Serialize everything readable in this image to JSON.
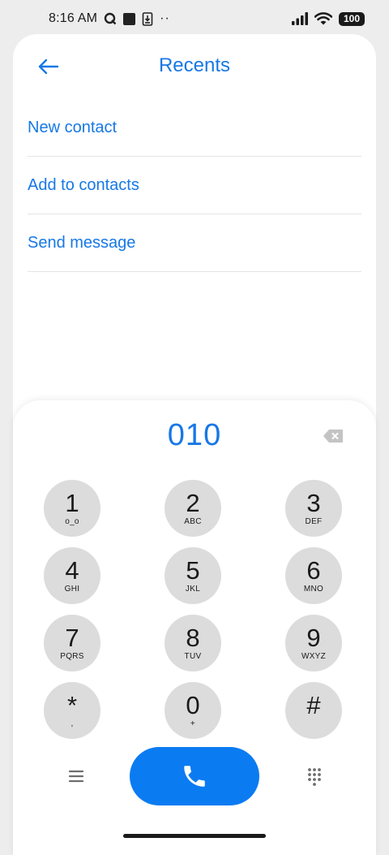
{
  "status_bar": {
    "time": "8:16 AM",
    "battery": "100",
    "icons": [
      "q-app-icon",
      "square-icon",
      "sim-download-icon",
      "more-dots-icon",
      "signal-icon",
      "wifi-icon",
      "battery-icon"
    ],
    "dots": "··"
  },
  "header": {
    "title": "Recents",
    "back_icon": "arrow-left-icon"
  },
  "menu": {
    "items": [
      {
        "label": "New contact"
      },
      {
        "label": "Add to contacts"
      },
      {
        "label": "Send message"
      }
    ]
  },
  "dialer": {
    "number": "010",
    "backspace_icon": "backspace-icon",
    "keys": [
      {
        "digit": "1",
        "letters": "o_o"
      },
      {
        "digit": "2",
        "letters": "ABC"
      },
      {
        "digit": "3",
        "letters": "DEF"
      },
      {
        "digit": "4",
        "letters": "GHI"
      },
      {
        "digit": "5",
        "letters": "JKL"
      },
      {
        "digit": "6",
        "letters": "MNO"
      },
      {
        "digit": "7",
        "letters": "PQRS"
      },
      {
        "digit": "8",
        "letters": "TUV"
      },
      {
        "digit": "9",
        "letters": "WXYZ"
      },
      {
        "digit": "*",
        "letters": ","
      },
      {
        "digit": "0",
        "letters": "+"
      },
      {
        "digit": "#",
        "letters": ""
      }
    ],
    "menu_icon": "hamburger-menu-icon",
    "call_icon": "phone-icon",
    "keypad_toggle_icon": "dialpad-icon"
  },
  "colors": {
    "accent": "#1778e6",
    "call_button": "#0b7bf2",
    "key_bg": "#dcdcdc",
    "page_bg": "#ededed"
  }
}
